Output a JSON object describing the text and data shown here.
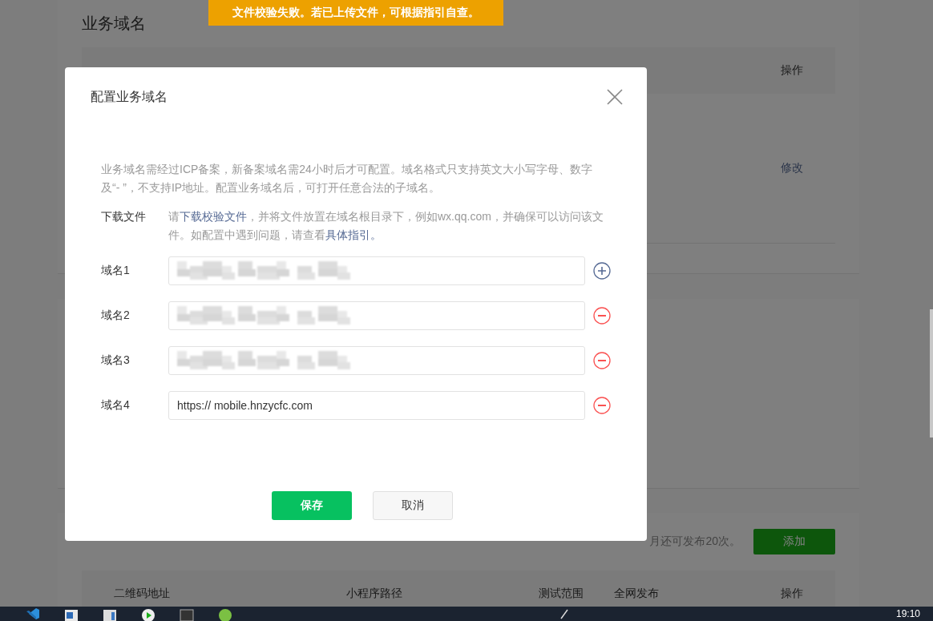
{
  "toast": {
    "text": "文件校验失败。若已上传文件，可根据指引自查。"
  },
  "background": {
    "section_1": {
      "title": "业务域名",
      "header_action": "操作",
      "row_action": "修改"
    },
    "section_2": {
      "quota": "月还可发布20次。",
      "add_button": "添加",
      "columns": [
        "二维码地址",
        "小程序路径",
        "测试范围",
        "全网发布",
        "操作"
      ]
    }
  },
  "dialog": {
    "title": "配置业务域名",
    "description": "业务域名需经过ICP备案，新备案域名需24小时后才可配置。域名格式只支持英文大小写字母、数字及“- ”，不支持IP地址。配置业务域名后，可打开任意合法的子域名。",
    "download": {
      "label": "下载文件",
      "parts": [
        {
          "text": "请",
          "link": false
        },
        {
          "text": "下载校验文件",
          "link": true
        },
        {
          "text": "，并将文件放置在域名根目录下，例如wx.qq.com，并确保可以访问该文件。如配置中遇到问题，请查看",
          "link": false
        },
        {
          "text": "具体指引。",
          "link": true
        }
      ]
    },
    "domains": [
      {
        "label": "域名1",
        "kind": "blurred",
        "removable": false
      },
      {
        "label": "域名2",
        "kind": "blurred",
        "removable": true
      },
      {
        "label": "域名3",
        "kind": "blurred",
        "removable": true
      },
      {
        "label": "域名4",
        "kind": "text",
        "value": "https:// mobile.hnzycfc.com",
        "removable": true
      }
    ],
    "buttons": [
      {
        "label": "保存",
        "kind": "primary"
      },
      {
        "label": "取消",
        "kind": "default"
      }
    ]
  },
  "taskbar": {
    "clock": "19:10"
  }
}
